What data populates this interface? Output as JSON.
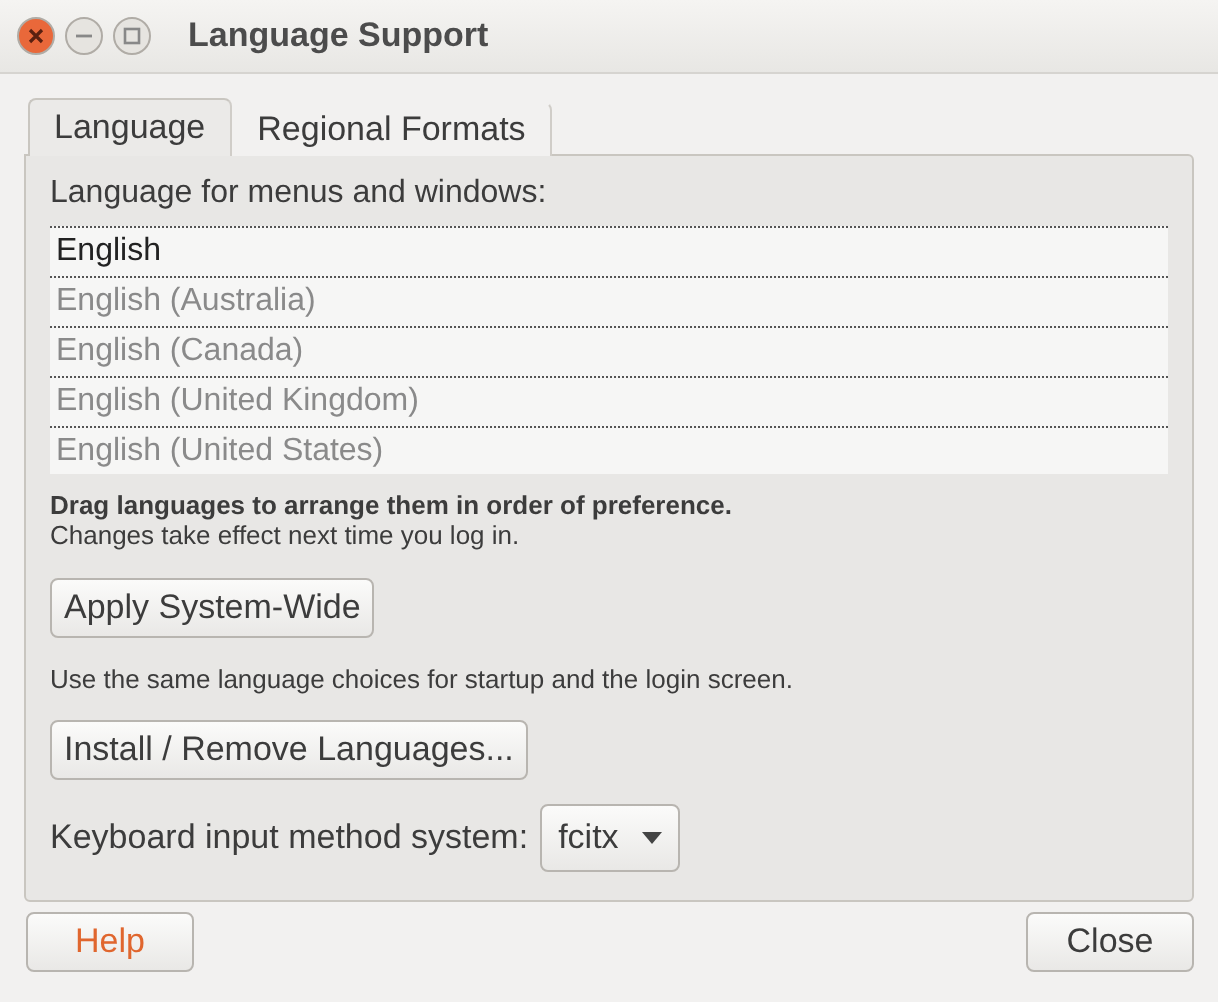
{
  "window": {
    "title": "Language Support"
  },
  "tabs": [
    {
      "label": "Language",
      "selected": true
    },
    {
      "label": "Regional Formats",
      "selected": false
    }
  ],
  "language_list": {
    "label": "Language for menus and windows:",
    "items": [
      {
        "name": "English",
        "dimmed": false
      },
      {
        "name": "English (Australia)",
        "dimmed": true
      },
      {
        "name": "English (Canada)",
        "dimmed": true
      },
      {
        "name": "English (United Kingdom)",
        "dimmed": true
      },
      {
        "name": "English (United States)",
        "dimmed": true
      }
    ]
  },
  "hint_bold": "Drag languages to arrange them in order of preference.",
  "hint": "Changes take effect next time you log in.",
  "apply_button": "Apply System-Wide",
  "apply_note": "Use the same language choices for startup and the login screen.",
  "install_button": "Install / Remove Languages...",
  "input_method": {
    "label": "Keyboard input method system:",
    "value": "fcitx"
  },
  "footer_buttons": [
    {
      "label": "Help",
      "kind": "help"
    },
    {
      "label": "Close",
      "kind": "close"
    }
  ]
}
